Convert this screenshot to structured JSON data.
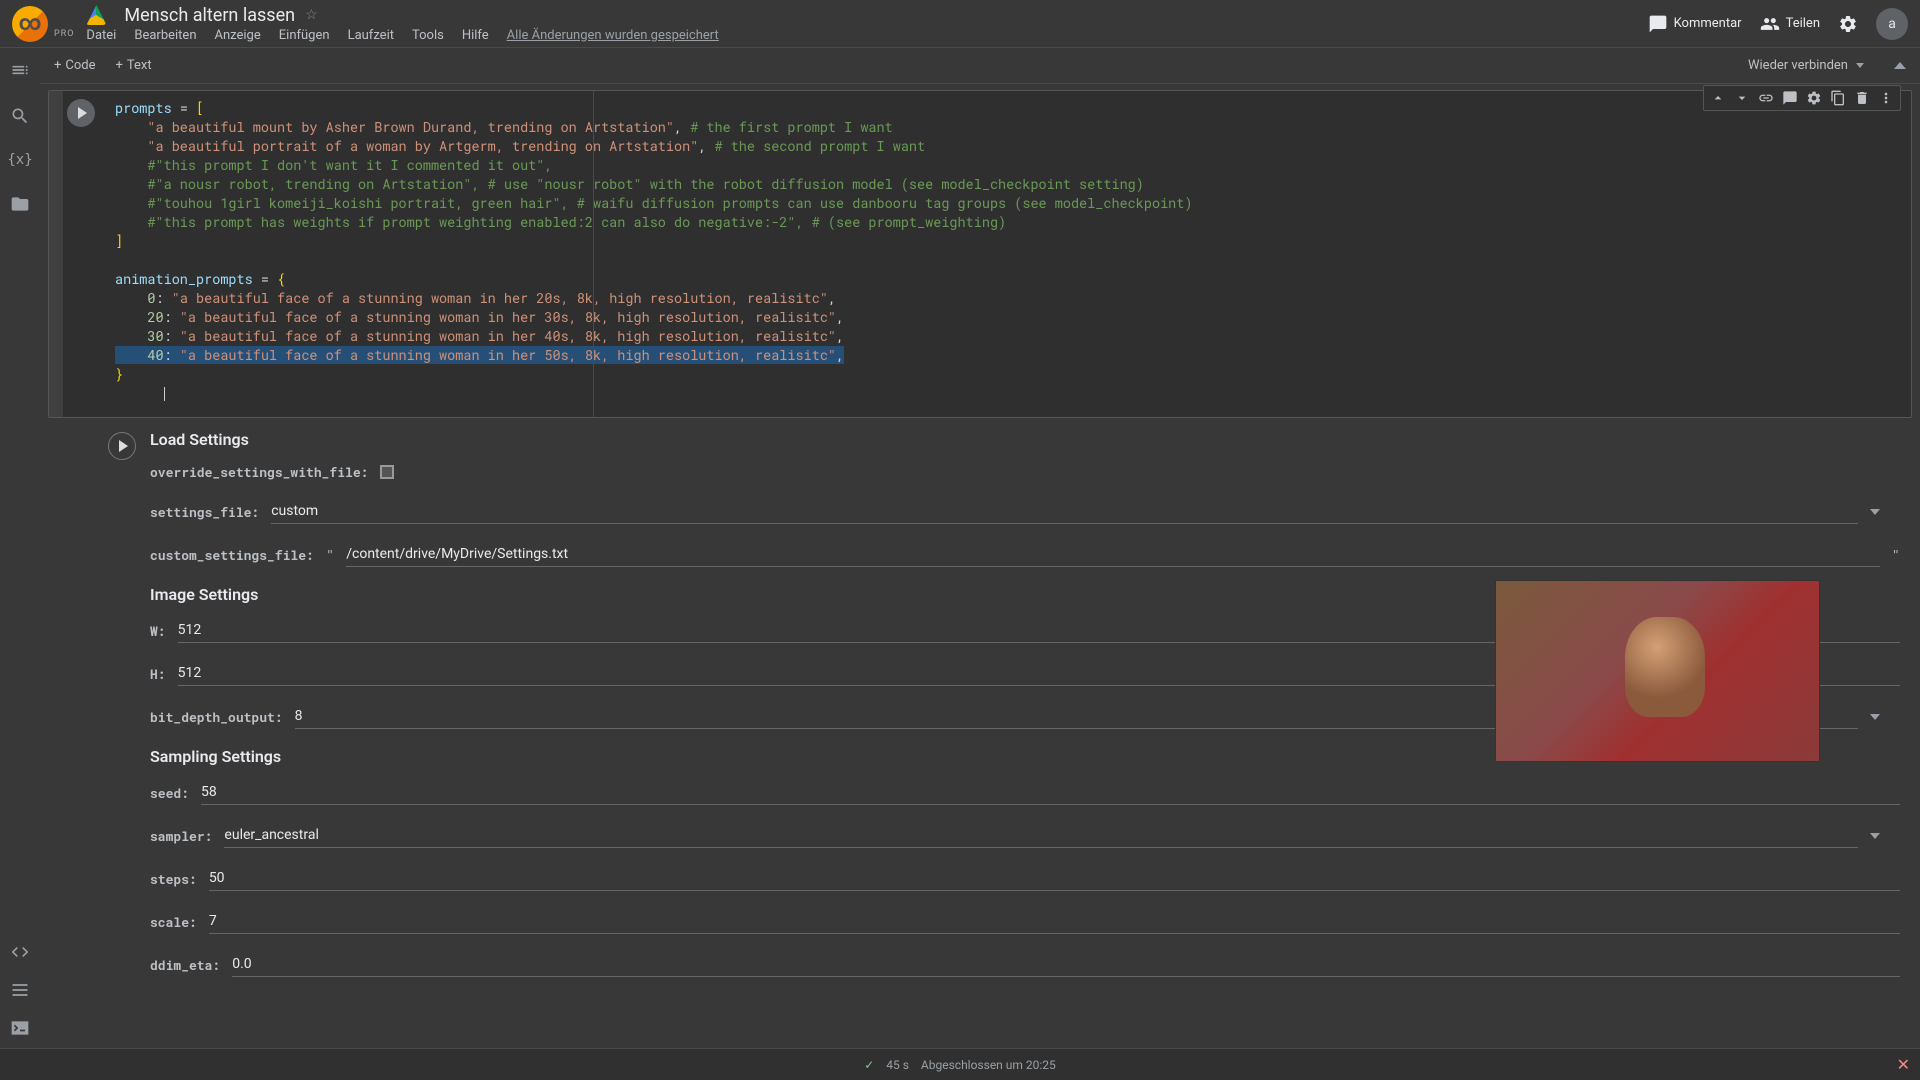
{
  "header": {
    "pro": "PRO",
    "title": "Mensch altern lassen",
    "menu": {
      "datei": "Datei",
      "bearbeiten": "Bearbeiten",
      "anzeige": "Anzeige",
      "einfuegen": "Einfügen",
      "laufzeit": "Laufzeit",
      "tools": "Tools",
      "hilfe": "Hilfe",
      "saved": "Alle Änderungen wurden gespeichert"
    },
    "kommentar": "Kommentar",
    "teilen": "Teilen",
    "avatar": "a"
  },
  "toolbar": {
    "code": "Code",
    "text": "Text",
    "reconnect": "Wieder verbinden"
  },
  "code": {
    "l1a": "prompts",
    "l1b": " = ",
    "l1c": "[",
    "l2a": "    ",
    "l2s": "\"a beautiful mount by Asher Brown Durand, trending on Artstation\"",
    "l2c": ", ",
    "l2m": "# the first prompt I want",
    "l3s": "\"a beautiful portrait of a woman by Artgerm, trending on Artstation\"",
    "l3c": ", ",
    "l3m": "# the second prompt I want",
    "l4": "#\"this prompt I don't want it I commented it out\",",
    "l5": "#\"a nousr robot, trending on Artstation\", # use \"nousr robot\" with the robot diffusion model (see model_checkpoint setting)",
    "l6": "#\"touhou 1girl komeiji_koishi portrait, green hair\", # waifu diffusion prompts can use danbooru tag groups (see model_checkpoint)",
    "l7": "#\"this prompt has weights if prompt weighting enabled:2 can also do negative:-2\", # (see prompt_weighting)",
    "l8": "]",
    "l10a": "animation_prompts",
    "l10b": " = ",
    "l10c": "{",
    "l11k": "0",
    "l11v": "\"a beautiful face of a stunning woman in her 20s, 8k, high resolution, realisitc\"",
    "l12k": "20",
    "l12v": "\"a beautiful face of a stunning woman in her 30s, 8k, high resolution, realisitc\"",
    "l13k": "30",
    "l13v": "\"a beautiful face of a stunning woman in her 40s, 8k, high resolution, realisitc\"",
    "l14k": "40",
    "l14v": "\"a beautiful face of a stunning woman in her 50s, 8k, high resolution, realisitc\"",
    "l15": "}"
  },
  "form": {
    "load_settings": "Load Settings",
    "override_label": "override_settings_with_file:",
    "settings_file_label": "settings_file:",
    "settings_file_value": "custom",
    "custom_file_label": "custom_settings_file:",
    "custom_file_value": "/content/drive/MyDrive/Settings.txt",
    "image_settings": "Image Settings",
    "w_label": "W:",
    "w_value": "512",
    "h_label": "H:",
    "h_value": "512",
    "bit_depth_label": "bit_depth_output:",
    "bit_depth_value": "8",
    "sampling_settings": "Sampling Settings",
    "seed_label": "seed:",
    "seed_value": "58",
    "sampler_label": "sampler:",
    "sampler_value": "euler_ancestral",
    "steps_label": "steps:",
    "steps_value": "50",
    "scale_label": "scale:",
    "scale_value": "7",
    "ddim_label": "ddim_eta:",
    "ddim_value": "0.0"
  },
  "footer": {
    "check": "✓",
    "time": "45 s",
    "status": "Abgeschlossen um 20:25"
  }
}
